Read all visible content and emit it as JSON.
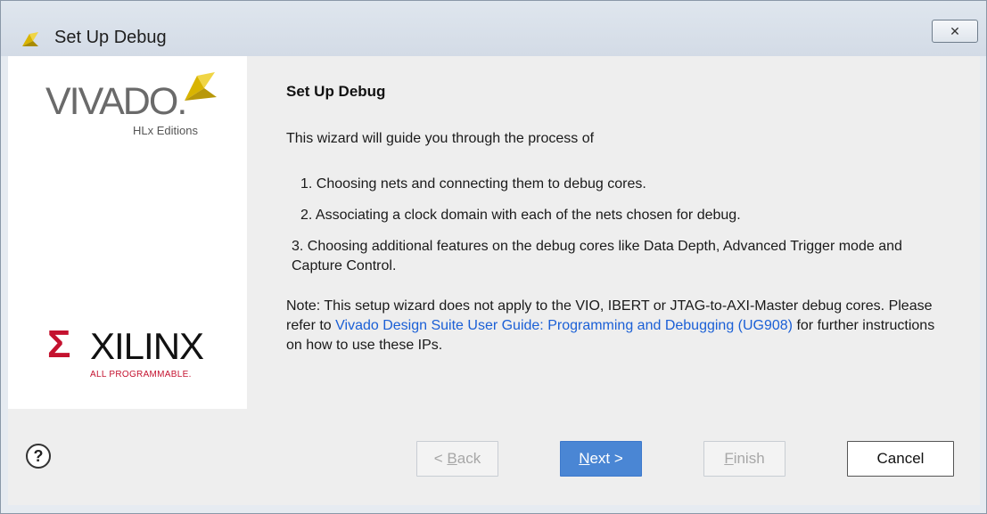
{
  "window": {
    "title": "Set Up Debug",
    "close_glyph": "✕"
  },
  "logos": {
    "vivado_word": "VIVADO",
    "vivado_mark": ".",
    "vivado_sub": "HLx Editions",
    "xilinx_word": "XILINX",
    "xilinx_tag": "ALL PROGRAMMABLE.",
    "xilinx_mark_glyph": "Σ"
  },
  "content": {
    "heading": "Set Up Debug",
    "intro": "This wizard will guide you through the process of",
    "steps": [
      "1. Choosing nets and connecting them to debug cores.",
      "2. Associating a clock domain with each of the nets chosen for debug.",
      "3. Choosing additional features on the debug cores like Data Depth, Advanced Trigger mode and Capture Control."
    ],
    "note_prefix": "Note: This setup wizard does not apply to the VIO, IBERT or JTAG-to-AXI-Master debug cores. Please refer to ",
    "note_link": "Vivado Design Suite User Guide: Programming and Debugging (UG908)",
    "note_suffix": " for further instructions on how to use these IPs."
  },
  "footer": {
    "help_glyph": "?",
    "back_prefix": "< ",
    "back_mnemonic": "B",
    "back_rest": "ack",
    "next_mnemonic": "N",
    "next_rest": "ext >",
    "finish_mnemonic": "F",
    "finish_rest": "inish",
    "cancel_label": "Cancel"
  },
  "colors": {
    "link": "#1a5fd6",
    "primary_button": "#4a86d4",
    "xilinx_red": "#c4122f",
    "vivado_yellow": "#e5c320"
  }
}
